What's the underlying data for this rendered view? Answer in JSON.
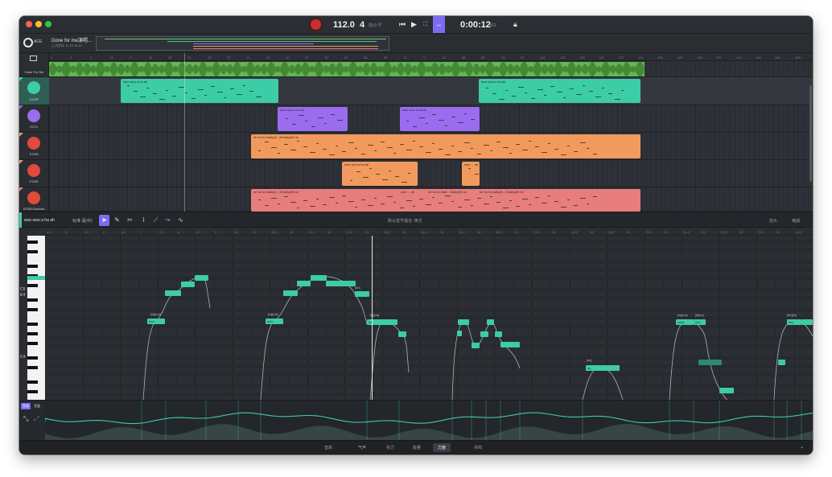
{
  "transport": {
    "tempo": "112.0",
    "beats": "4",
    "beats_unit": "拍/小节",
    "timecode": "0:00:12",
    "timecode_unit": ":661"
  },
  "project": {
    "logo_text": "ACE",
    "name": "Done for me演唱...",
    "subtitle": "上次保存 11-26 14:37"
  },
  "tracks": [
    {
      "name": "Done For Me",
      "color": "#6ecf5a"
    },
    {
      "name": "EG2R",
      "color": "#3ccca6"
    },
    {
      "name": "EG7L",
      "color": "#9b6cf0"
    },
    {
      "name": "EG0D",
      "color": "#f29a5e"
    },
    {
      "name": "EG0D",
      "color": "#f29a5e"
    },
    {
      "name": "EG0D-DoubleL",
      "color": "#e87d7d"
    }
  ],
  "ruler_ticks": [
    "1",
    "5",
    "9",
    "13",
    "17",
    "21",
    "25",
    "29",
    "33",
    "37",
    "41",
    "45",
    "49",
    "53",
    "57",
    "61",
    "65",
    "69",
    "73",
    "77",
    "81",
    "85",
    "89",
    "93",
    "97",
    "101",
    "105",
    "109",
    "113",
    "117",
    "121",
    "125",
    "129",
    "133",
    "137",
    "141",
    "145",
    "149",
    "153"
  ],
  "clips": {
    "eg2r": [
      "woo woo a ha ah",
      "woo woo a ha ah"
    ],
    "eg7l": [
      "woo woo a ha ah",
      "woo woo a ha ah"
    ],
    "eg0d_a": [
      "oh ho ho baby(h...)ff baby(f2 ne"
    ],
    "eg0d_b": [
      "woo woo a ha ah",
      "woo ... ah"
    ],
    "eg0d_c": [
      "oh ho ho baby(h...)ff baby(f2 ne",
      "woo ... ah",
      "oh ho ho bab...f baby(f2 ne",
      "oh ho ho baby(h...)f baby(f2 ne"
    ]
  },
  "piano_roll": {
    "clip_name": "woo woo a ha ah",
    "mode": "标准 语(中)",
    "lang": "默认音节语言: 英文",
    "right_1": "放大",
    "right_2": "缩减",
    "key_c5": "C5",
    "key_e4": "E4",
    "key_c4": "C4",
    "bar_labels": [
      "4.2",
      "5",
      "5.2",
      "6",
      "6.2",
      "7",
      "7.2",
      "8",
      "8.2",
      "9",
      "9.2",
      "10",
      "10.2",
      "11",
      "11.2",
      "12",
      "12.2",
      "13",
      "13.2",
      "14",
      "14.2",
      "15",
      "15.2",
      "16",
      "16.2",
      "17",
      "17.2",
      "18",
      "18.2",
      "19",
      "19.2",
      "20",
      "20.2",
      "21",
      "21.2",
      "22",
      "22.2",
      "23",
      "23.2",
      "24",
      "24.2"
    ],
    "phonemes": [
      "[w][uw]",
      "[w][uw]",
      "[ah]",
      "[h][aa]",
      "[ay]",
      "[w][uw]",
      "[k][ey]",
      "[dh][ih]"
    ],
    "note_words": [
      "woo",
      "woo",
      "ha",
      "ay",
      "what",
      "you",
      "this"
    ]
  },
  "param_tabs": [
    "音高",
    "音量"
  ],
  "bottom_tabs": [
    "音高",
    "气声",
    "张力",
    "能量",
    "力度",
    "共鸣"
  ],
  "bottom_active": "力度"
}
